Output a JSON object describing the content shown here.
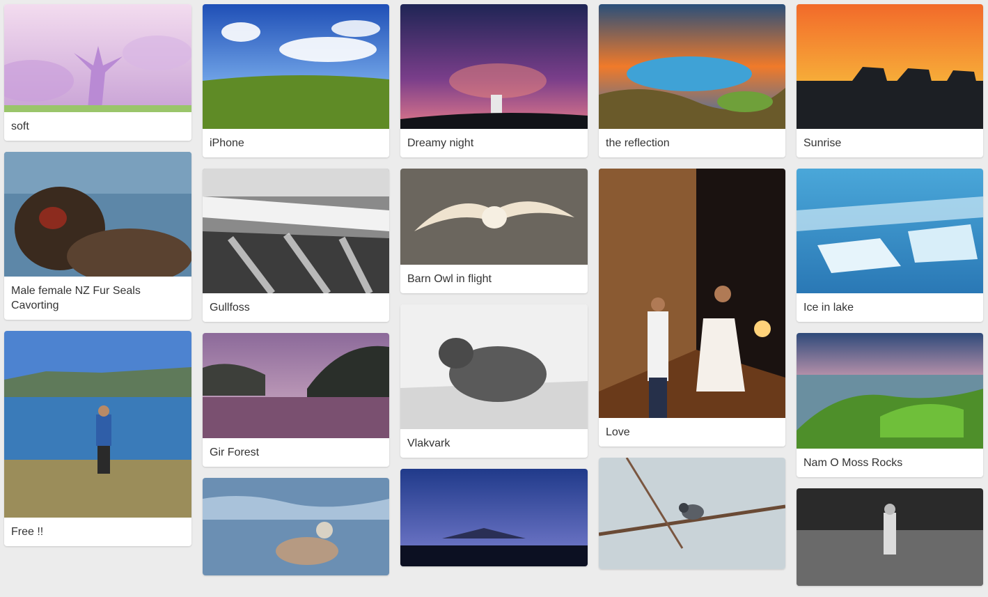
{
  "gallery": {
    "col1": [
      {
        "title": "soft"
      },
      {
        "title": "Male female NZ Fur Seals Cavorting"
      },
      {
        "title": "Free !!"
      }
    ],
    "col2": [
      {
        "title": "iPhone"
      },
      {
        "title": "Gullfoss"
      },
      {
        "title": "Gir Forest"
      },
      {
        "title": ""
      }
    ],
    "col3": [
      {
        "title": "Dreamy night"
      },
      {
        "title": "Barn Owl in flight"
      },
      {
        "title": "Vlakvark"
      },
      {
        "title": ""
      }
    ],
    "col4": [
      {
        "title": "the reflection"
      },
      {
        "title": "Love"
      },
      {
        "title": ""
      }
    ],
    "col5": [
      {
        "title": "Sunrise"
      },
      {
        "title": "Ice in lake"
      },
      {
        "title": "Nam O Moss Rocks"
      },
      {
        "title": ""
      }
    ]
  }
}
